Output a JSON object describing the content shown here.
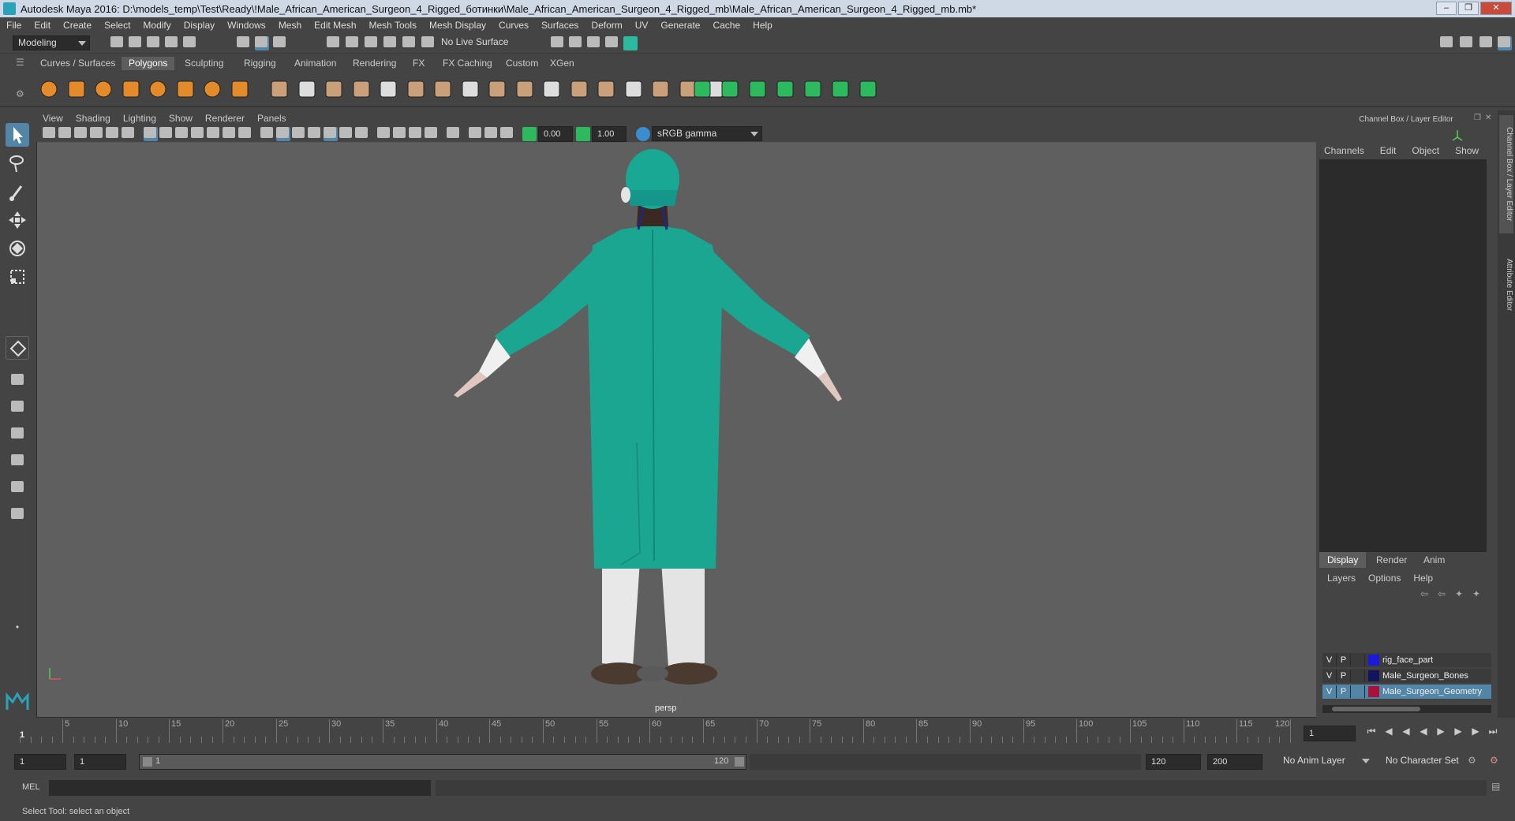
{
  "window": {
    "title": "Autodesk Maya 2016: D:\\models_temp\\Test\\Ready\\!Male_African_American_Surgeon_4_Rigged_ботинки\\Male_African_American_Surgeon_4_Rigged_mb\\Male_African_American_Surgeon_4_Rigged_mb.mb*"
  },
  "menubar": [
    "File",
    "Edit",
    "Create",
    "Select",
    "Modify",
    "Display",
    "Windows",
    "Mesh",
    "Edit Mesh",
    "Mesh Tools",
    "Mesh Display",
    "Curves",
    "Surfaces",
    "Deform",
    "UV",
    "Generate",
    "Cache",
    "Help"
  ],
  "statusline": {
    "mode": "Modeling",
    "live_surface": "No Live Surface"
  },
  "shelf_tabs": [
    "Curves / Surfaces",
    "Polygons",
    "Sculpting",
    "Rigging",
    "Animation",
    "Rendering",
    "FX",
    "FX Caching",
    "Custom",
    "XGen"
  ],
  "shelf_active": "Polygons",
  "panel_menu": [
    "View",
    "Shading",
    "Lighting",
    "Show",
    "Renderer",
    "Panels"
  ],
  "panel_toolbar": {
    "exposure": "0.00",
    "gamma": "1.00",
    "color_space": "sRGB gamma"
  },
  "viewport": {
    "camera": "persp"
  },
  "channel_box": {
    "title": "Channel Box / Layer Editor",
    "menu": [
      "Channels",
      "Edit",
      "Object",
      "Show"
    ]
  },
  "side_tabs": [
    "Channel Box / Layer Editor",
    "Attribute Editor"
  ],
  "layer_editor": {
    "tabs": [
      "Display",
      "Render",
      "Anim"
    ],
    "active_tab": "Display",
    "menu": [
      "Layers",
      "Options",
      "Help"
    ],
    "layers": [
      {
        "v": "V",
        "p": "P",
        "name": "rig_face_part",
        "color": "#1a1ad8",
        "selected": false
      },
      {
        "v": "V",
        "p": "P",
        "name": "Male_Surgeon_Bones",
        "color": "#14145e",
        "selected": false
      },
      {
        "v": "V",
        "p": "P",
        "name": "Male_Surgeon_Geometry",
        "color": "#a8123a",
        "selected": true
      }
    ]
  },
  "timeline": {
    "labels": [
      "5",
      "10",
      "15",
      "20",
      "25",
      "30",
      "35",
      "40",
      "45",
      "50",
      "55",
      "60",
      "65",
      "70",
      "75",
      "80",
      "85",
      "90",
      "95",
      "100",
      "105",
      "110",
      "115",
      "120"
    ],
    "current_frame_marker": "1",
    "current_frame_field": "1"
  },
  "range": {
    "start": "1",
    "inner_start": "1",
    "slider_start": "1",
    "slider_end": "120",
    "end": "120",
    "total_end": "200",
    "anim_layer": "No Anim Layer",
    "character_set": "No Character Set"
  },
  "command": {
    "label": "MEL"
  },
  "help_line": "Select Tool: select an object"
}
